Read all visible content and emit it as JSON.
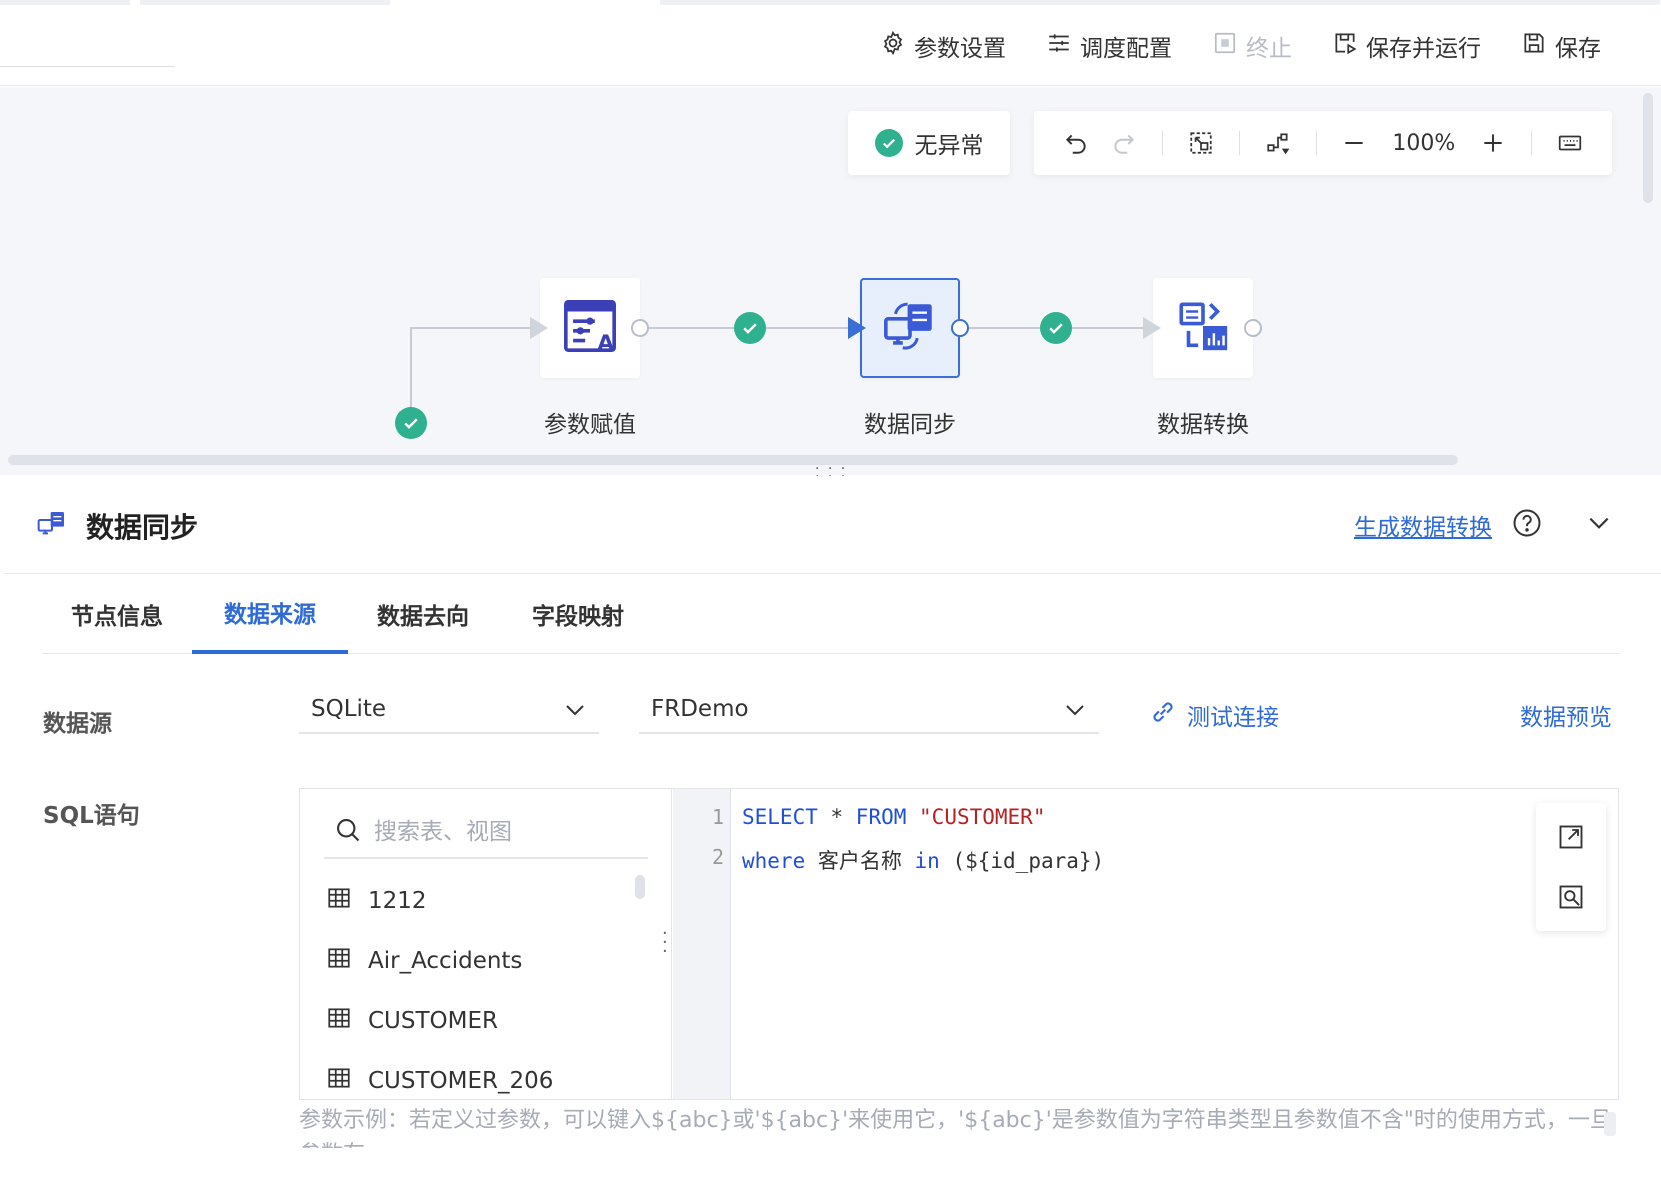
{
  "toolbar": {
    "params_settings": "参数设置",
    "schedule_config": "调度配置",
    "terminate": "终止",
    "save_and_run": "保存并运行",
    "save": "保存"
  },
  "canvas": {
    "status": "无异常",
    "zoom": "100%",
    "nodes": [
      {
        "label": "参数赋值",
        "icon": "param-assign-icon"
      },
      {
        "label": "数据同步",
        "icon": "data-sync-icon",
        "selected": true
      },
      {
        "label": "数据转换",
        "icon": "data-transform-icon"
      }
    ]
  },
  "panel": {
    "title": "数据同步",
    "generate_link": "生成数据转换",
    "tabs": [
      "节点信息",
      "数据来源",
      "数据去向",
      "字段映射"
    ],
    "active_tab": 1,
    "datasource_label": "数据源",
    "datasource_type": "SQLite",
    "datasource_name": "FRDemo",
    "test_connection": "测试连接",
    "data_preview": "数据预览",
    "sql_label": "SQL语句",
    "search_placeholder": "搜索表、视图",
    "tables": [
      "1212",
      "Air_Accidents",
      "CUSTOMER",
      "CUSTOMER_206"
    ],
    "line_numbers": [
      "1",
      "2"
    ],
    "sql": {
      "line1": {
        "kw1": "SELECT",
        "mid": " * ",
        "kw2": "FROM",
        "sp": " ",
        "str": "\"CUSTOMER\""
      },
      "line2": {
        "kw1": "where",
        "mid": " 客户名称 ",
        "kw2": "in",
        "rest": " (${id_para})"
      }
    },
    "hint": "参数示例：若定义过参数，可以键入${abc}或'${abc}'来使用它，'${abc}'是参数值为字符串类型且参数值不含\"时的使用方式，一旦参数存"
  },
  "colors": {
    "accent": "#2f6bd6",
    "success": "#2fb08f",
    "node_icon": "#3b3fb8"
  }
}
